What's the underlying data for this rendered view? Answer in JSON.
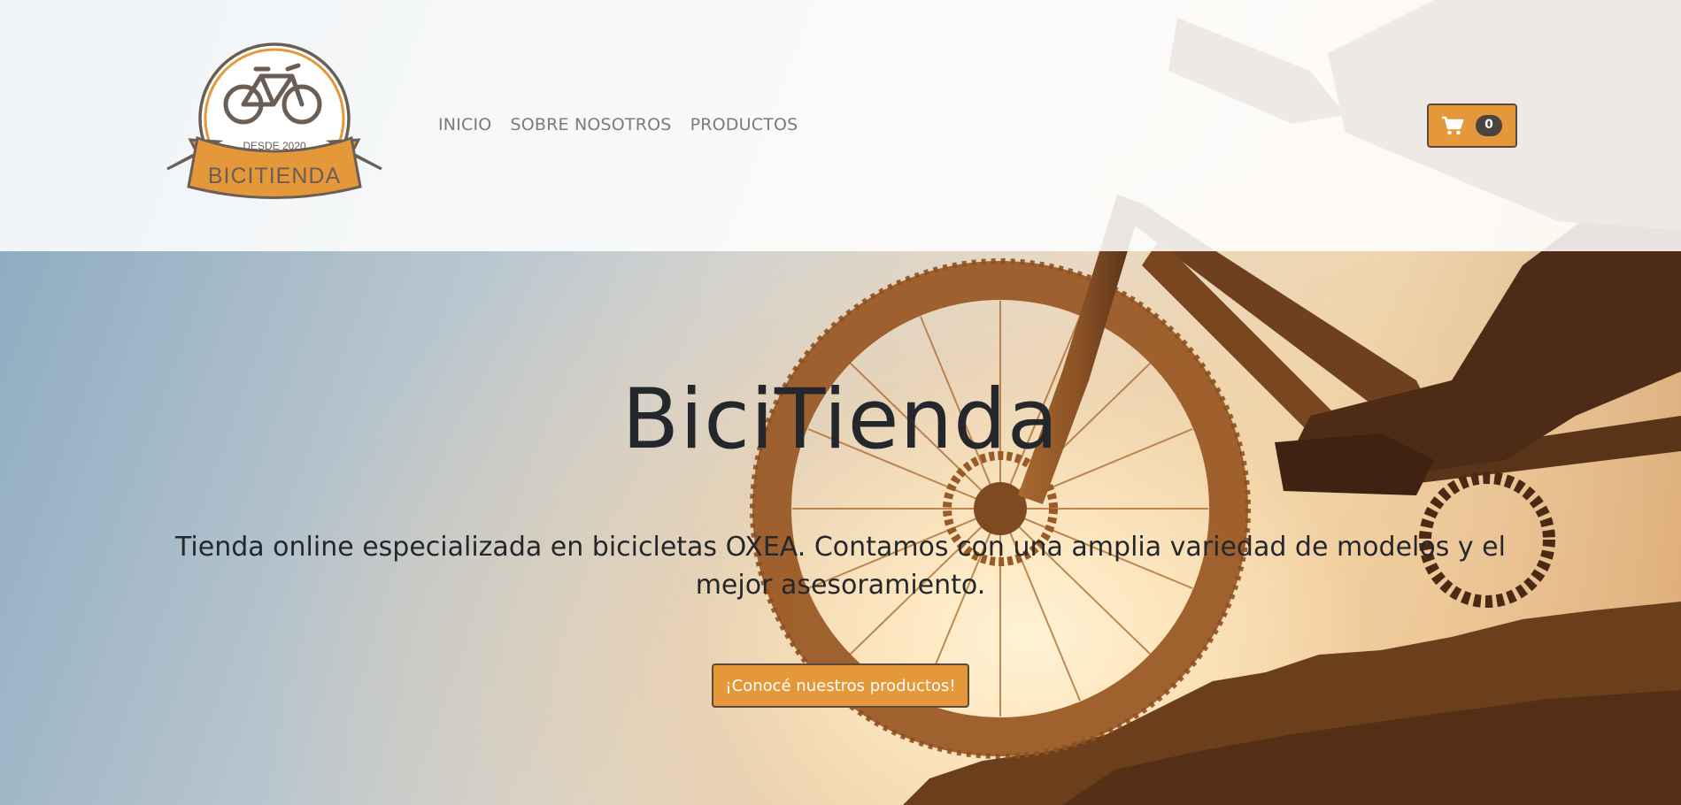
{
  "brand": {
    "badge_year": "DESDE 2020",
    "badge_name": "BICITIENDA"
  },
  "nav": {
    "links": [
      {
        "label": "INICIO"
      },
      {
        "label": "SOBRE NOSOTROS"
      },
      {
        "label": "PRODUCTOS"
      }
    ]
  },
  "cart": {
    "icon": "shopping-cart-icon",
    "count": "0"
  },
  "hero": {
    "title": "BiciTienda",
    "subtitle": "Tienda online especializada en bicicletas OXEA. Contamos con una amplia variedad de modelos y el mejor asesoramiento.",
    "cta_label": "¡Conocé nuestros productos!",
    "background": "mountain-bike-silhouette-sunset-photo"
  },
  "colors": {
    "accent": "#e4983a",
    "dark": "#24272b",
    "nav_text": "#7b7b7b",
    "badge_bg": "#4a4440"
  }
}
